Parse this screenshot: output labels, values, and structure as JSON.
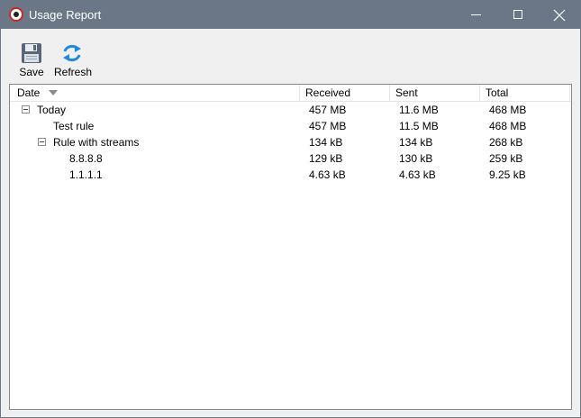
{
  "window": {
    "title": "Usage Report"
  },
  "toolbar": {
    "save_label": "Save",
    "refresh_label": "Refresh"
  },
  "table": {
    "columns": {
      "date": "Date",
      "received": "Received",
      "sent": "Sent",
      "total": "Total"
    },
    "rows": [
      {
        "name": "Today",
        "level": 0,
        "expandable": true,
        "received": "457 MB",
        "sent": "11.6 MB",
        "total": "468 MB"
      },
      {
        "name": "Test rule",
        "level": 1,
        "expandable": false,
        "received": "457 MB",
        "sent": "11.5 MB",
        "total": "468 MB"
      },
      {
        "name": "Rule with streams",
        "level": 1,
        "expandable": true,
        "received": "134 kB",
        "sent": "134 kB",
        "total": "268 kB"
      },
      {
        "name": "8.8.8.8",
        "level": 2,
        "expandable": false,
        "received": "129 kB",
        "sent": "130 kB",
        "total": "259 kB"
      },
      {
        "name": "1.1.1.1",
        "level": 2,
        "expandable": false,
        "received": "4.63 kB",
        "sent": "4.63 kB",
        "total": "9.25 kB"
      }
    ]
  },
  "colors": {
    "titlebar": "#6b7787",
    "refresh_icon": "#1e88e5",
    "save_icon": "#5a6677"
  }
}
